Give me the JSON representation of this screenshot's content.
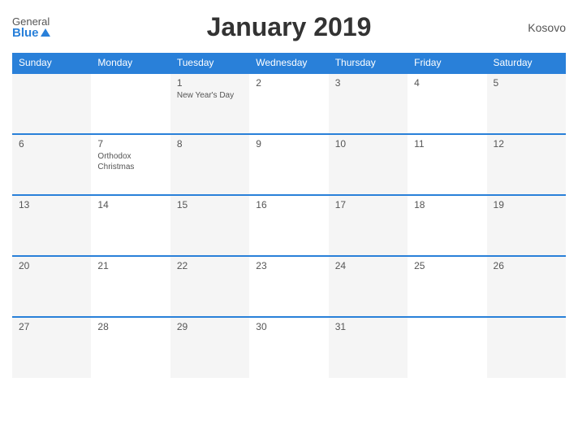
{
  "header": {
    "title": "January 2019",
    "country": "Kosovo",
    "logo_general": "General",
    "logo_blue": "Blue"
  },
  "weekdays": [
    "Sunday",
    "Monday",
    "Tuesday",
    "Wednesday",
    "Thursday",
    "Friday",
    "Saturday"
  ],
  "weeks": [
    [
      {
        "day": "",
        "holiday": ""
      },
      {
        "day": "",
        "holiday": ""
      },
      {
        "day": "1",
        "holiday": "New Year's Day"
      },
      {
        "day": "2",
        "holiday": ""
      },
      {
        "day": "3",
        "holiday": ""
      },
      {
        "day": "4",
        "holiday": ""
      },
      {
        "day": "5",
        "holiday": ""
      }
    ],
    [
      {
        "day": "6",
        "holiday": ""
      },
      {
        "day": "7",
        "holiday": "Orthodox Christmas"
      },
      {
        "day": "8",
        "holiday": ""
      },
      {
        "day": "9",
        "holiday": ""
      },
      {
        "day": "10",
        "holiday": ""
      },
      {
        "day": "11",
        "holiday": ""
      },
      {
        "day": "12",
        "holiday": ""
      }
    ],
    [
      {
        "day": "13",
        "holiday": ""
      },
      {
        "day": "14",
        "holiday": ""
      },
      {
        "day": "15",
        "holiday": ""
      },
      {
        "day": "16",
        "holiday": ""
      },
      {
        "day": "17",
        "holiday": ""
      },
      {
        "day": "18",
        "holiday": ""
      },
      {
        "day": "19",
        "holiday": ""
      }
    ],
    [
      {
        "day": "20",
        "holiday": ""
      },
      {
        "day": "21",
        "holiday": ""
      },
      {
        "day": "22",
        "holiday": ""
      },
      {
        "day": "23",
        "holiday": ""
      },
      {
        "day": "24",
        "holiday": ""
      },
      {
        "day": "25",
        "holiday": ""
      },
      {
        "day": "26",
        "holiday": ""
      }
    ],
    [
      {
        "day": "27",
        "holiday": ""
      },
      {
        "day": "28",
        "holiday": ""
      },
      {
        "day": "29",
        "holiday": ""
      },
      {
        "day": "30",
        "holiday": ""
      },
      {
        "day": "31",
        "holiday": ""
      },
      {
        "day": "",
        "holiday": ""
      },
      {
        "day": "",
        "holiday": ""
      }
    ]
  ]
}
